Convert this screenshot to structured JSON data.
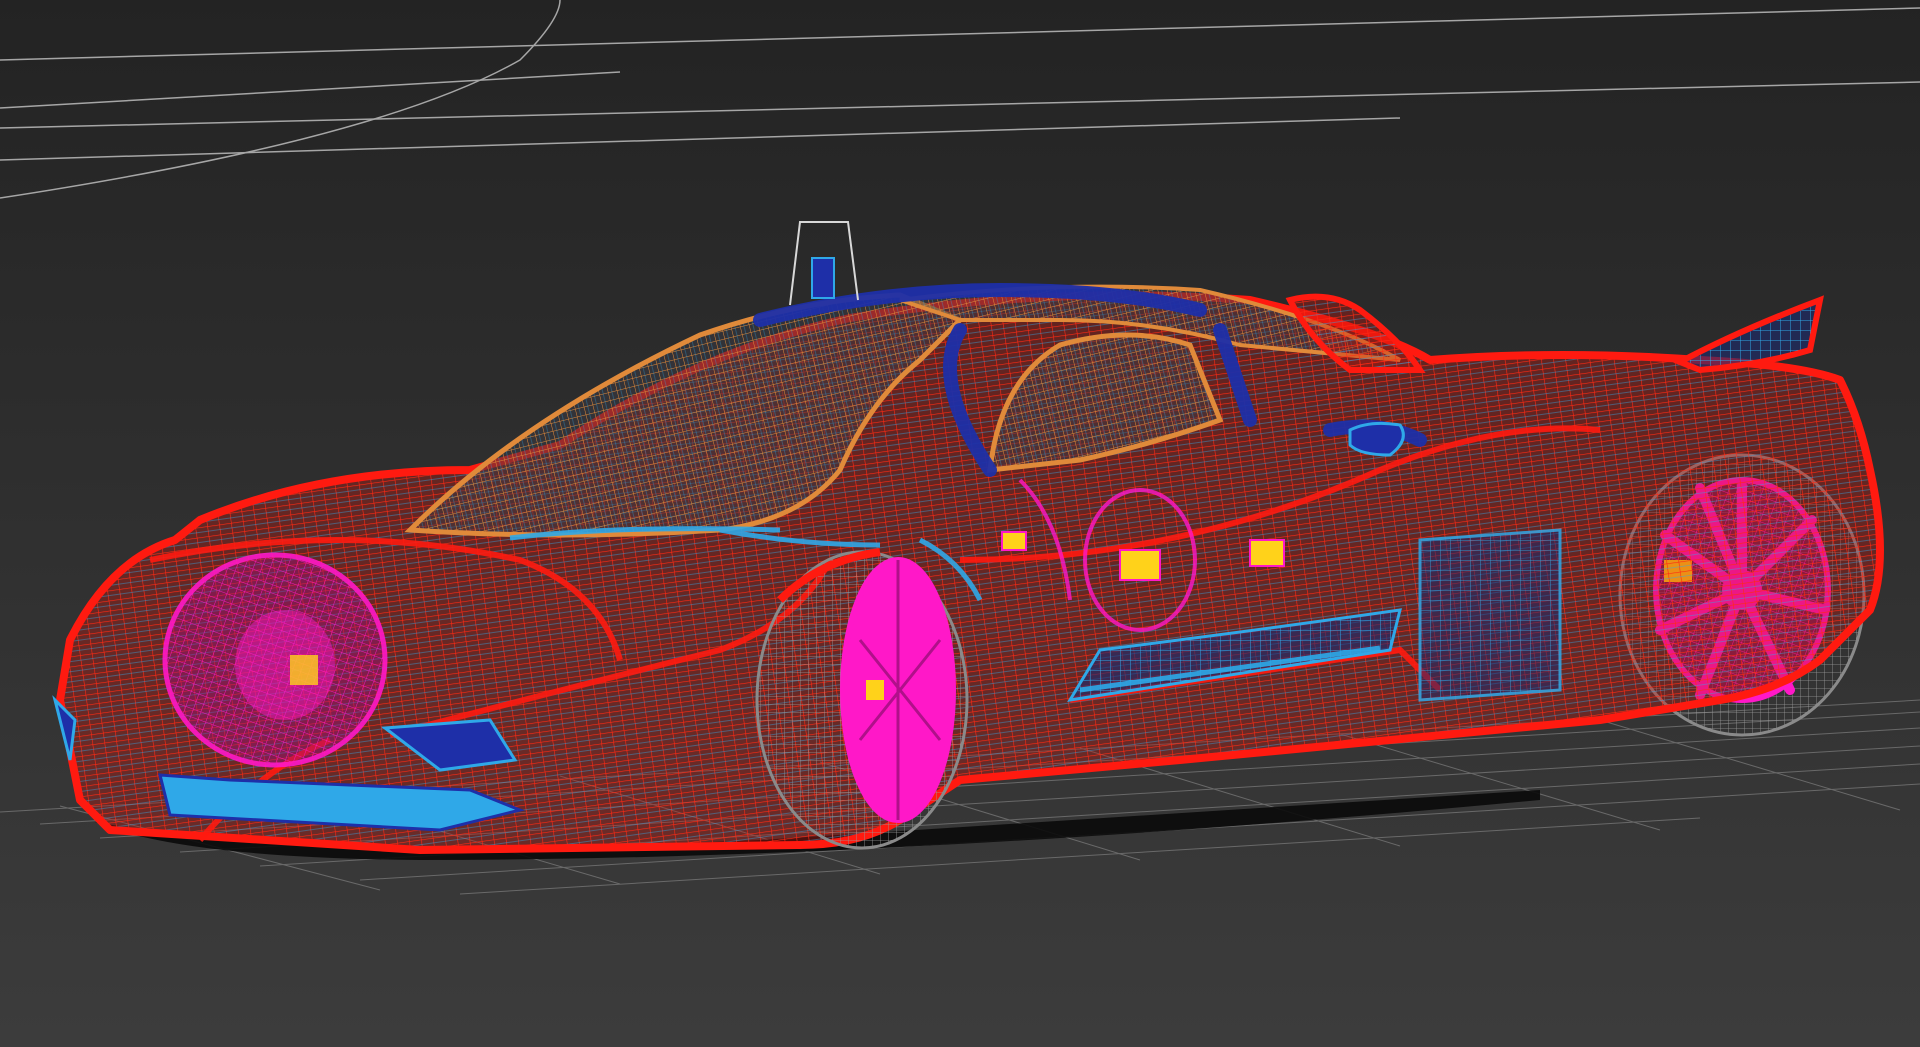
{
  "viewport": {
    "shading_mode": "wireframe",
    "projection": "perspective",
    "background_top": "#232323",
    "background_bottom": "#3c3c3c"
  },
  "scene": {
    "model": "sports-car",
    "wire_colors": {
      "body": "#ff1a10",
      "glass": "#e08a3a",
      "roof_trim": "#1e2fa8",
      "detail": "#2fa8e8",
      "wheels": "#ff18c8",
      "tires": "#8a8a8a",
      "interior": "#ffd21a",
      "shadow": "#0a0a0a"
    },
    "grid_color": "#7a7a7a",
    "guide_lines_color": "#bdbdbd"
  }
}
